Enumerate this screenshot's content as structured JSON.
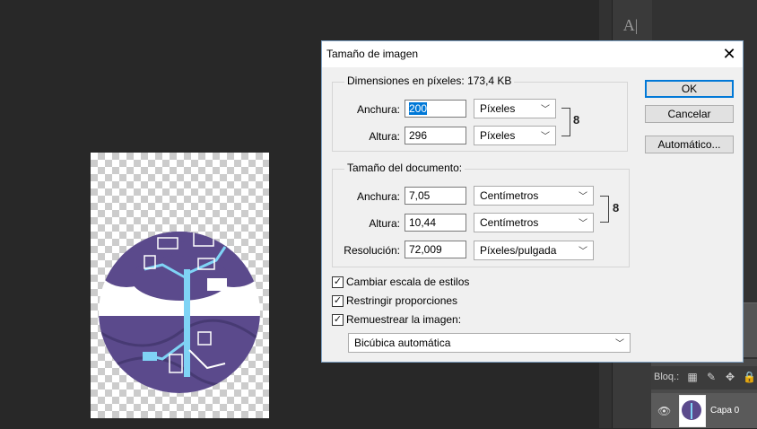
{
  "dialog": {
    "title": "Tamaño de imagen",
    "close_glyph": "✕",
    "pixel_dimensions": {
      "legend": "Dimensiones en píxeles: 173,4 KB",
      "width_label": "Anchura:",
      "width_value": "200",
      "width_unit": "Píxeles",
      "height_label": "Altura:",
      "height_value": "296",
      "height_unit": "Píxeles"
    },
    "document_size": {
      "legend": "Tamaño del documento:",
      "width_label": "Anchura:",
      "width_value": "7,05",
      "width_unit": "Centímetros",
      "height_label": "Altura:",
      "height_value": "10,44",
      "height_unit": "Centímetros",
      "resolution_label": "Resolución:",
      "resolution_value": "72,009",
      "resolution_unit": "Píxeles/pulgada"
    },
    "checkboxes": {
      "scale_styles": "Cambiar escala de estilos",
      "constrain": "Restringir proporciones",
      "resample": "Remuestrear la imagen:"
    },
    "resample_method": "Bicúbica automática",
    "buttons": {
      "ok": "OK",
      "cancel": "Cancelar",
      "auto": "Automático..."
    }
  },
  "panels": {
    "lock_label": "Bloq.:",
    "layer_name": "Capa 0",
    "char_icon": "A|"
  },
  "colors": {
    "accent": "#0078d7",
    "workspace": "#282828",
    "tree_purple": "#5b4a8c",
    "tree_cyan": "#7fd3f5"
  }
}
